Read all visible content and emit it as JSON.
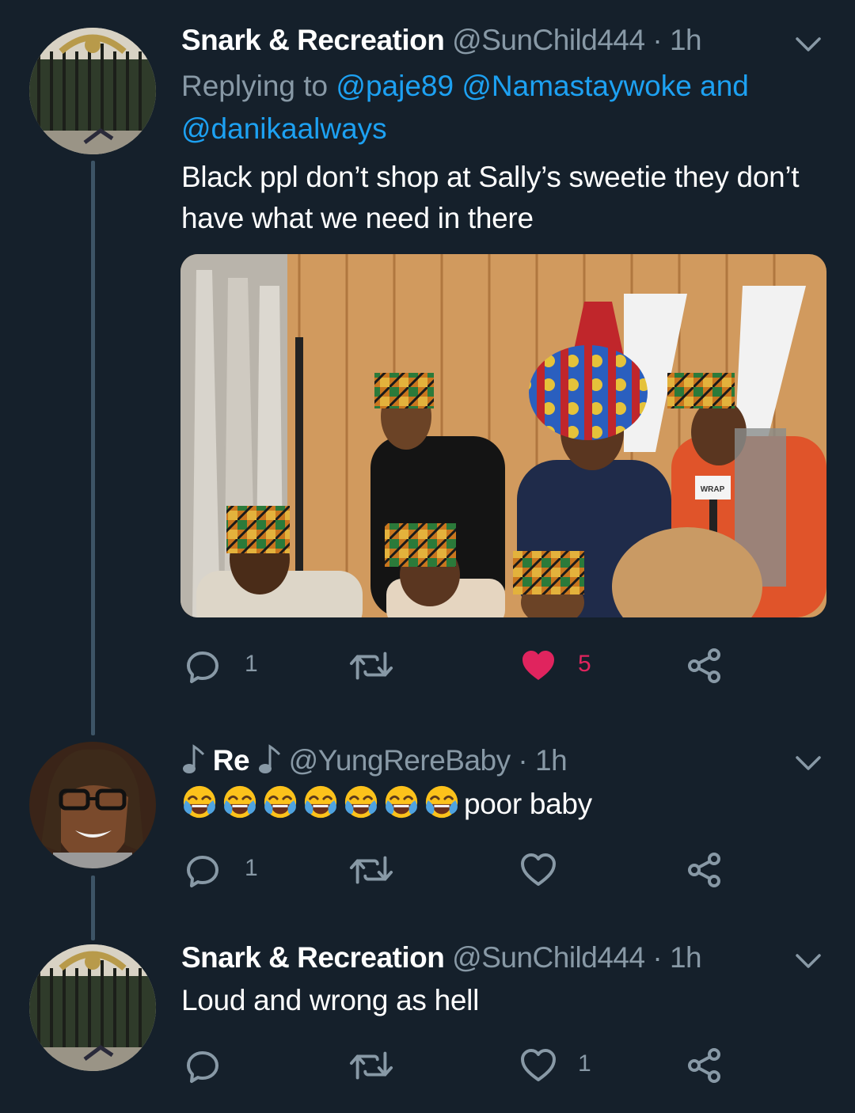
{
  "tweets": [
    {
      "name": "Snark & Recreation",
      "handle": "@SunChild444",
      "separator": "·",
      "time": "1h",
      "replying_prefix": "Replying to",
      "replying_handles": [
        "@paje89",
        "@Namastaywoke"
      ],
      "replying_and": "and",
      "replying_last": "@danikaalways",
      "text_line1": "Black ppl don’t shop at Sally’s sweetie they don’t",
      "text_line2": "have what we need in there",
      "media_watermark": "WRAP",
      "reply_count": "1",
      "like_count": "5",
      "liked": true
    },
    {
      "name": "Re",
      "name_decoration": "♪",
      "handle": "@YungRereBaby",
      "separator": "·",
      "time": "1h",
      "emoji_name": "face-with-tears-of-joy",
      "emoji_count": 7,
      "text": "poor baby",
      "reply_count": "1",
      "liked": false
    },
    {
      "name": "Snark & Recreation",
      "handle": "@SunChild444",
      "separator": "·",
      "time": "1h",
      "text": "Loud and wrong as hell",
      "like_count": "1",
      "liked": false
    }
  ],
  "colors": {
    "background": "#15202b",
    "secondary_text": "#8899a6",
    "link": "#1da1f2",
    "like": "#e0245e",
    "thread_line": "#3d5466"
  },
  "icons": [
    "reply-icon",
    "retweet-icon",
    "like-icon",
    "share-icon",
    "chevron-down-icon",
    "music-note-icon"
  ]
}
